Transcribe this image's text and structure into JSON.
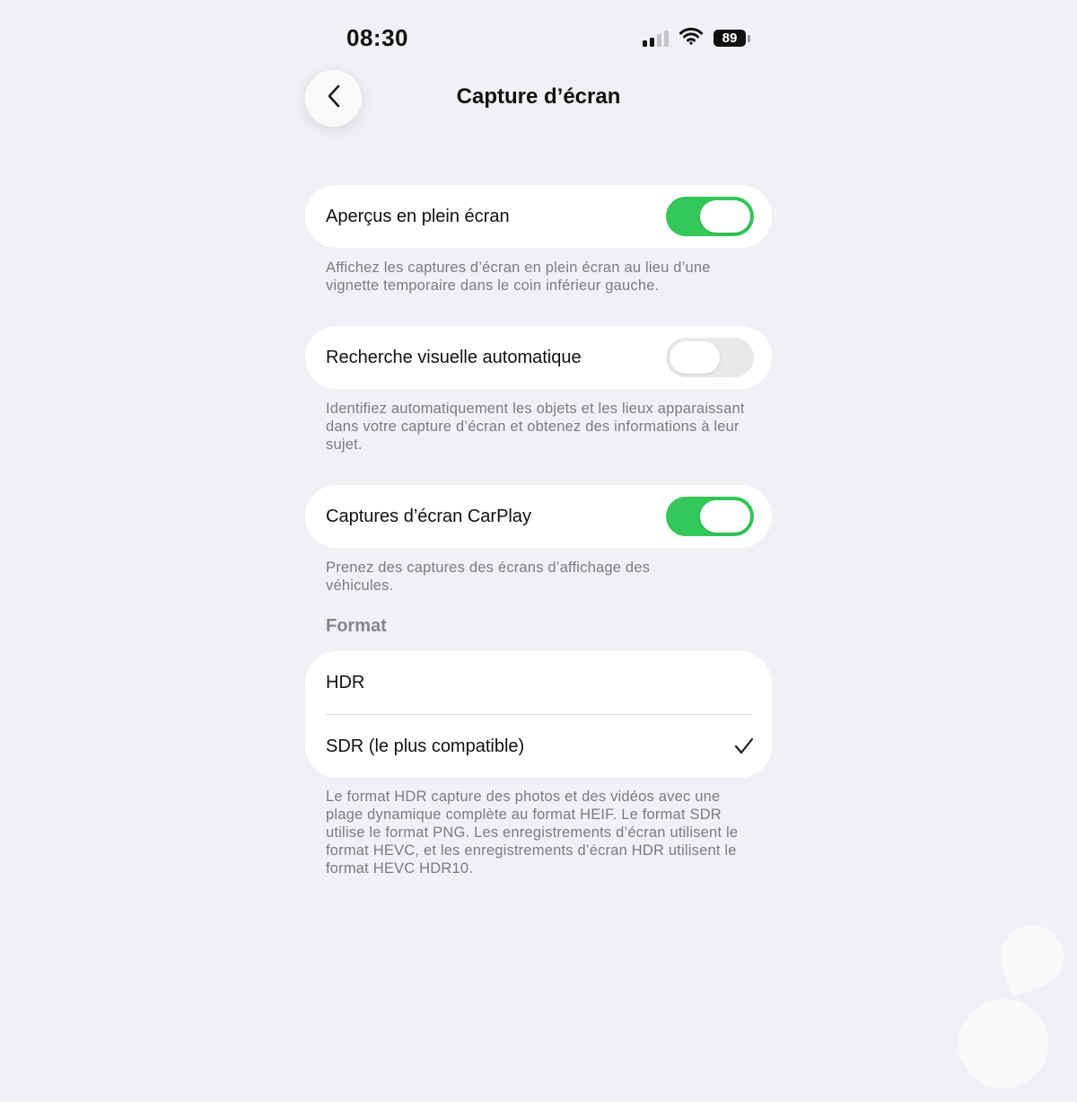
{
  "status_bar": {
    "time": "08:30",
    "battery": "89",
    "signal_icon": "cellular-signal-icon",
    "wifi_icon": "wifi-icon"
  },
  "nav": {
    "title": "Capture d’écran",
    "back_icon": "chevron-left-icon"
  },
  "settings": {
    "fullscreen": {
      "label": "Aperçus en plein écran",
      "enabled": true,
      "footnote": "Affichez les captures d’écran en plein écran au lieu d’une vignette temporaire dans le coin inférieur gauche."
    },
    "visual_lookup": {
      "label": "Recherche visuelle automatique",
      "enabled": false,
      "footnote": "Identifiez automatiquement les objets et les lieux apparaissant dans votre capture d’écran et obtenez des informations à leur sujet."
    },
    "carplay": {
      "label": "Captures d’écran CarPlay",
      "enabled": true,
      "footnote": "Prenez des captures des écrans d’affichage des véhicules."
    }
  },
  "format": {
    "header": "Format",
    "options": [
      {
        "label": "HDR",
        "selected": false
      },
      {
        "label": "SDR (le plus compatible)",
        "selected": true
      }
    ],
    "footnote": "Le format HDR capture des photos et des vidéos avec une plage dynamique complète au format HEIF. Le format SDR utilise le format PNG. Les enregistrements d’écran utilisent le format HEVC, et les enregistrements d’écran HDR utilisent le format HEVC HDR10."
  },
  "colors": {
    "accent_green": "#34c759",
    "background": "#f1f1f5",
    "card": "#ffffff",
    "footnote_text": "#7b7b80"
  }
}
